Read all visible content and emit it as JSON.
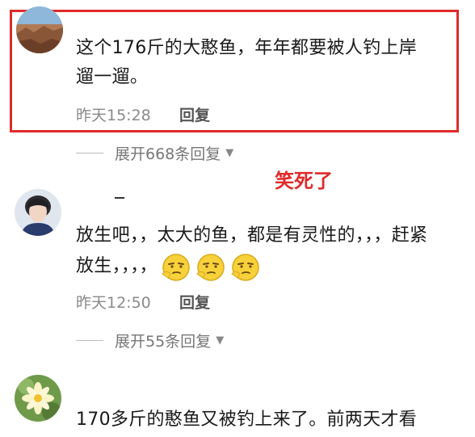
{
  "comments": [
    {
      "text_line1": "这个176斤的大憨鱼，年年都要被人钓上岸",
      "text_line2": "遛一遛。",
      "time": "昨天15:28",
      "reply_label": "回复",
      "expand_label": "展开668条回复"
    },
    {
      "text_line1": "放生吧，，太大的鱼，都是有灵性的，，，赶紧",
      "text_line2": "放生，，，，",
      "emoji_count": 3,
      "time": "昨天12:50",
      "reply_label": "回复",
      "expand_label": "展开55条回复"
    },
    {
      "text_line1": "170多斤的憨鱼又被钓上来了。前两天才看"
    }
  ],
  "annotation": "笑死了",
  "colors": {
    "highlight": "#e02a2a",
    "emoji_yellow": "#f7d13a"
  }
}
